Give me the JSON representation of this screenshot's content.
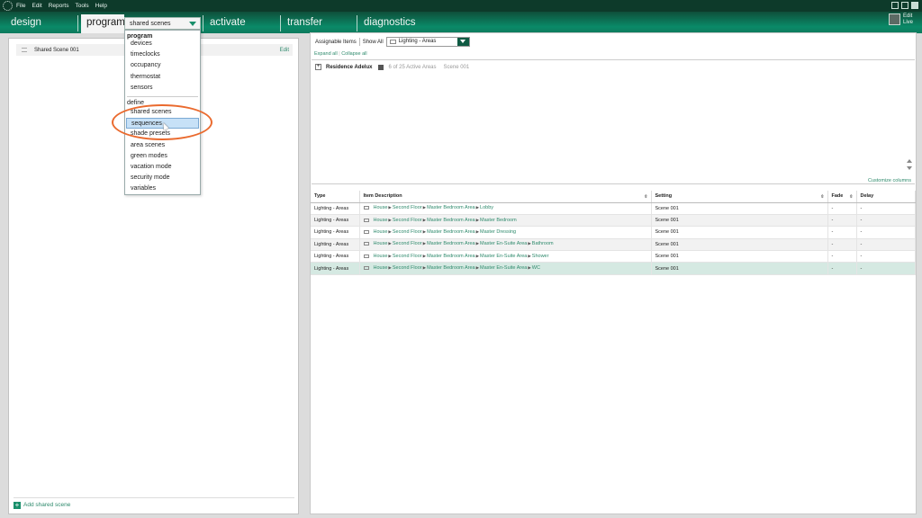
{
  "menubar": {
    "items": [
      "File",
      "Edit",
      "Reports",
      "Tools",
      "Help"
    ]
  },
  "nav": {
    "tabs": [
      "design",
      "program",
      "activate",
      "transfer",
      "diagnostics"
    ],
    "program_select": "shared scenes",
    "edit_live": [
      "Edit",
      "Live"
    ]
  },
  "dropdown": {
    "group_program": "program",
    "program_items": [
      "devices",
      "timeclocks",
      "occupancy",
      "thermostat",
      "sensors"
    ],
    "group_define": "define",
    "define_items": [
      "shared scenes",
      "sequences",
      "shade presets",
      "area scenes",
      "green modes",
      "vacation mode",
      "security mode",
      "variables"
    ],
    "highlighted": "sequences"
  },
  "left_panel": {
    "scene_name": "Shared Scene 001",
    "edit_label": "Edit",
    "add_label": "Add shared scene"
  },
  "right_panel": {
    "assignable_label": "Assignable Items",
    "show_all_label": "Show All",
    "area_filter": "Lighting - Areas",
    "expand_all": "Expand all",
    "collapse_all": "Collapse all",
    "residence_name": "Residence Adelux",
    "active_areas": "6 of 25 Active Areas",
    "scene_label": "Scene 001",
    "customize_columns": "Customize columns"
  },
  "table": {
    "headers": [
      "Type",
      "Item Description",
      "Setting",
      "Fade",
      "Delay"
    ],
    "rows": [
      {
        "type": "Lighting - Areas",
        "path": [
          "House",
          "Second Floor",
          "Master Bedroom Area",
          "Lobby"
        ],
        "setting": "Scene 001",
        "fade": "-",
        "delay": "-"
      },
      {
        "type": "Lighting - Areas",
        "path": [
          "House",
          "Second Floor",
          "Master Bedroom Area",
          "Master Bedroom"
        ],
        "setting": "Scene 001",
        "fade": "-",
        "delay": "-"
      },
      {
        "type": "Lighting - Areas",
        "path": [
          "House",
          "Second Floor",
          "Master Bedroom Area",
          "Master Dressing"
        ],
        "setting": "Scene 001",
        "fade": "-",
        "delay": "-"
      },
      {
        "type": "Lighting - Areas",
        "path": [
          "House",
          "Second Floor",
          "Master Bedroom Area",
          "Master En-Suite Area",
          "Bathroom"
        ],
        "setting": "Scene 001",
        "fade": "-",
        "delay": "-"
      },
      {
        "type": "Lighting - Areas",
        "path": [
          "House",
          "Second Floor",
          "Master Bedroom Area",
          "Master En-Suite Area",
          "Shower"
        ],
        "setting": "Scene 001",
        "fade": "-",
        "delay": "-"
      },
      {
        "type": "Lighting - Areas",
        "path": [
          "House",
          "Second Floor",
          "Master Bedroom Area",
          "Master En-Suite Area",
          "WC"
        ],
        "setting": "Scene 001",
        "fade": "-",
        "delay": "-"
      }
    ]
  },
  "colors": {
    "accent": "#1a8f6b",
    "nav_dark": "#0d3a2a",
    "highlight_ring": "#ea6a2e",
    "link": "#2e8a6c"
  }
}
